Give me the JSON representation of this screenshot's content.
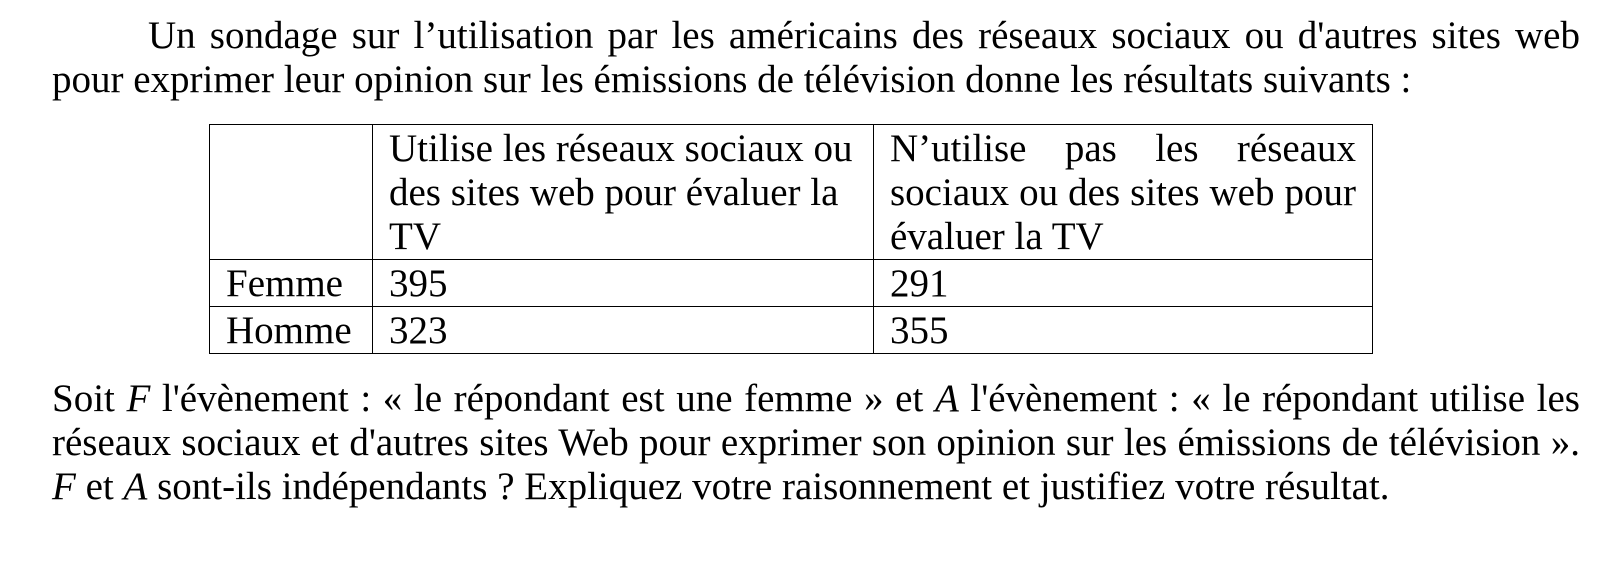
{
  "intro_text": "Un sondage sur l’utilisation par les américains des réseaux sociaux ou d'autres sites web pour exprimer leur opinion sur les émissions de télévision donne les résultats suivants :",
  "table": {
    "headers": [
      "",
      "Utilise les réseaux sociaux ou des sites web pour évaluer la TV",
      "N’utilise pas les réseaux sociaux ou des sites web pour évaluer la TV"
    ],
    "rows": [
      {
        "label": "Femme",
        "values": [
          "395",
          "291"
        ]
      },
      {
        "label": "Homme",
        "values": [
          "323",
          "355"
        ]
      }
    ]
  },
  "question": {
    "p1": "Soit ",
    "event_f": "F",
    "p2": " l'évènement : « le répondant est une femme » et ",
    "event_a": "A",
    "p3": " l'évènement : « le répondant utilise les réseaux sociaux et d'autres sites Web pour exprimer son opinion sur les émissions de télévision ». ",
    "event_f2": "F",
    "p4": " et ",
    "event_a2": "A",
    "p5": " sont-ils indépendants ? Expliquez votre raisonnement et justifiez votre résultat."
  }
}
